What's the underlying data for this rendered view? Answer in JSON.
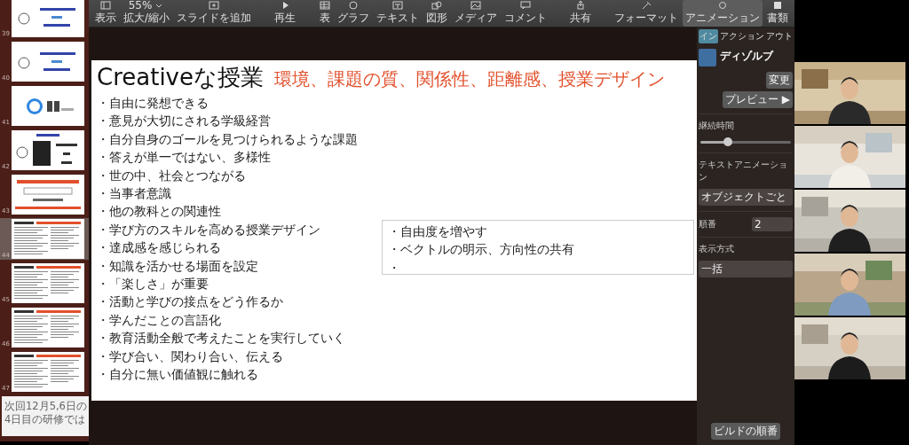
{
  "slides_sidebar": {
    "thumbnails": [
      {
        "number": "39",
        "kind": "breakout",
        "selected": false
      },
      {
        "number": "40",
        "kind": "breakout",
        "selected": false
      },
      {
        "number": "41",
        "kind": "timer",
        "selected": false
      },
      {
        "number": "42",
        "kind": "talk",
        "selected": false
      },
      {
        "number": "43",
        "kind": "title",
        "selected": false
      },
      {
        "number": "44",
        "kind": "dense",
        "selected": true
      },
      {
        "number": "45",
        "kind": "dense",
        "selected": false
      },
      {
        "number": "46",
        "kind": "dense",
        "selected": false
      },
      {
        "number": "47",
        "kind": "dense",
        "selected": false
      },
      {
        "kind": "text",
        "lines": [
          "次回12月5,6日の",
          "4日目の研修では"
        ],
        "selected": false
      }
    ]
  },
  "toolbar": {
    "left": [
      {
        "label": "表示"
      },
      {
        "label": "拡大/縮小",
        "value": "55%"
      },
      {
        "label": "スライドを追加"
      }
    ],
    "center": [
      {
        "label": "再生"
      }
    ],
    "insert": [
      {
        "label": "表"
      },
      {
        "label": "グラフ"
      },
      {
        "label": "テキスト"
      },
      {
        "label": "図形"
      },
      {
        "label": "メディア"
      },
      {
        "label": "コメント"
      }
    ],
    "share": [
      {
        "label": "共有"
      }
    ],
    "right": [
      {
        "label": "フォーマット",
        "selected": false
      },
      {
        "label": "アニメーション",
        "selected": true
      },
      {
        "label": "書類",
        "selected": false
      }
    ]
  },
  "slide": {
    "title": "Creativeな授業",
    "subtitle": "環境、課題の質、関係性、距離感、授業デザイン",
    "bullets": [
      "・自由に発想できる",
      "・意見が大切にされる学級経営",
      "・自分自身のゴールを見つけられるような課題",
      "・答えが単一ではない、多様性",
      "・世の中、社会とつながる",
      "・当事者意識",
      "・他の教科との関連性",
      "・学び方のスキルを高める授業デザイン",
      "・達成感を感じられる",
      "・知識を活かせる場面を設定",
      "・「楽しさ」が重要",
      "・活動と学びの接点をどう作るか",
      "・学んだことの言語化",
      "・教育活動全般で考えたことを実行していく",
      "・学び合い、関わり合い、伝える",
      "・自分に無い価値観に触れる"
    ],
    "text_box": [
      "・自由度を増やす",
      "・ベクトルの明示、方向性の共有",
      "・"
    ]
  },
  "inspector": {
    "tabs": [
      {
        "label": "イン",
        "selected": true
      },
      {
        "label": "アクション",
        "selected": false
      },
      {
        "label": "アウト",
        "selected": false
      }
    ],
    "effect": "ディゾルブ",
    "change_button": "変更",
    "preview_button": "プレビュー ▶",
    "duration": {
      "label": "継続時間",
      "level": 0.3
    },
    "text_animation": {
      "label": "テキストアニメーション",
      "value": "オブジェクトごと"
    },
    "order": {
      "label": "順番",
      "value": "2"
    },
    "delivery": {
      "label": "表示方式",
      "value": "一括"
    },
    "build_order_button": "ビルドの順番"
  }
}
